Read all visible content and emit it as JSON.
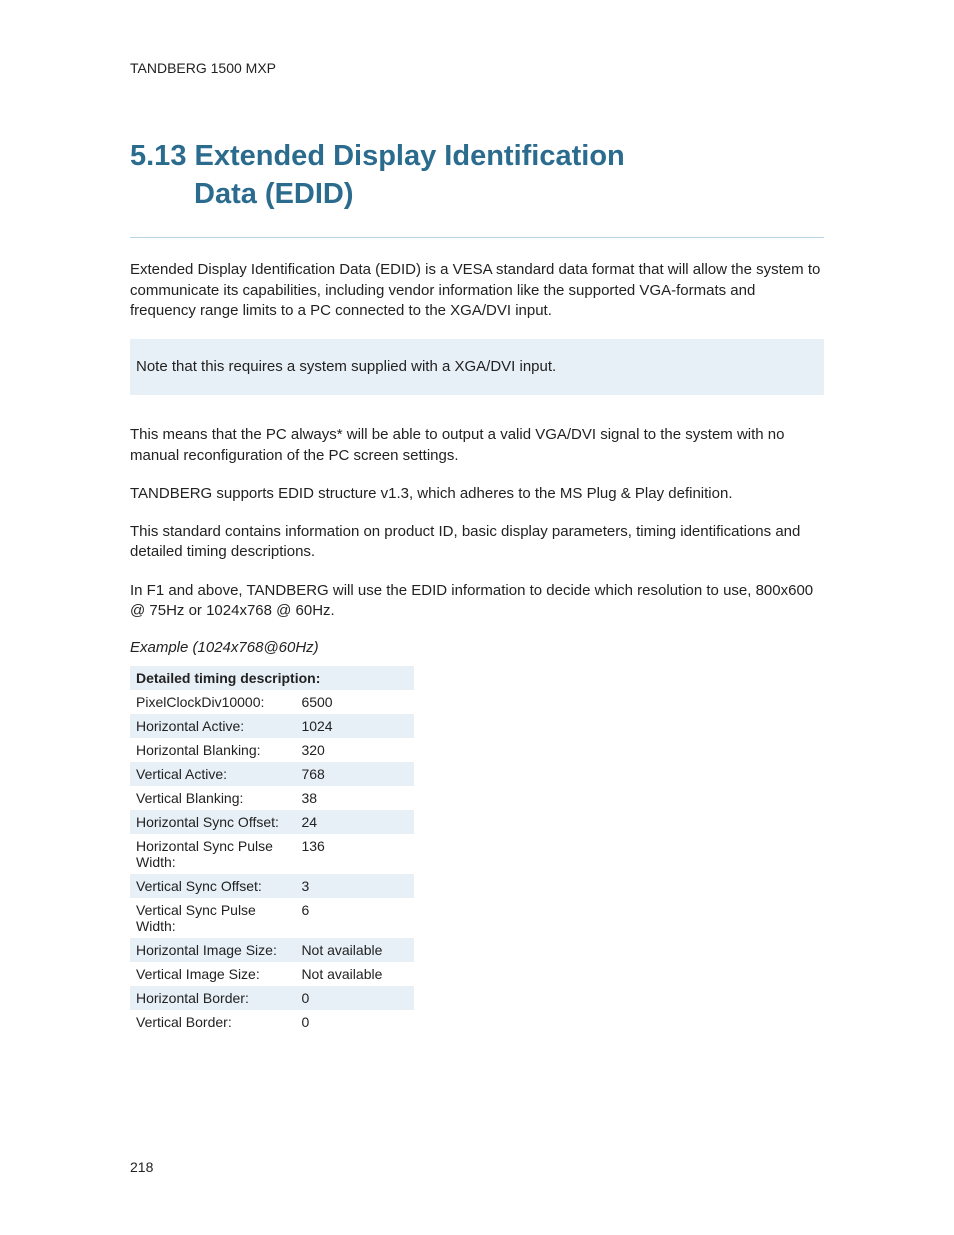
{
  "header": "TANDBERG 1500 MXP",
  "title_line1": "5.13 Extended Display Identification",
  "title_line2": "Data (EDID)",
  "para1": "Extended Display Identification Data (EDID) is a VESA standard data format that will allow the system to communicate its capabilities, including vendor information like the supported VGA-formats and frequency range limits to a PC connected to the XGA/DVI input.",
  "note": "Note that this requires a system supplied with a XGA/DVI input.",
  "para2": "This means that the PC always* will be able to output a valid VGA/DVI signal to the system with no manual reconfiguration of the PC screen settings.",
  "para3": "TANDBERG supports EDID structure v1.3, which adheres to the MS Plug & Play definition.",
  "para4": "This standard contains information on product ID, basic display parameters, timing identifications and detailed timing descriptions.",
  "para5": "In F1 and above, TANDBERG will use the EDID information to decide which resolution to use, 800x600 @ 75Hz or 1024x768 @ 60Hz.",
  "example_caption": "Example (1024x768@60Hz)",
  "table_header": "Detailed timing description:",
  "rows": [
    {
      "label": "PixelClockDiv10000:",
      "value": "6500"
    },
    {
      "label": "Horizontal Active:",
      "value": "1024"
    },
    {
      "label": "Horizontal Blanking:",
      "value": "320"
    },
    {
      "label": "Vertical Active:",
      "value": "768"
    },
    {
      "label": "Vertical Blanking:",
      "value": "38"
    },
    {
      "label": "Horizontal Sync Offset:",
      "value": "24"
    },
    {
      "label": "Horizontal Sync Pulse Width:",
      "value": "136"
    },
    {
      "label": "Vertical Sync Offset:",
      "value": "3"
    },
    {
      "label": "Vertical Sync Pulse Width:",
      "value": "6"
    },
    {
      "label": "Horizontal Image Size:",
      "value": "Not available"
    },
    {
      "label": "Vertical Image Size:",
      "value": "Not available"
    },
    {
      "label": "Horizontal Border:",
      "value": "0"
    },
    {
      "label": "Vertical Border:",
      "value": "0"
    }
  ],
  "page_number": "218"
}
